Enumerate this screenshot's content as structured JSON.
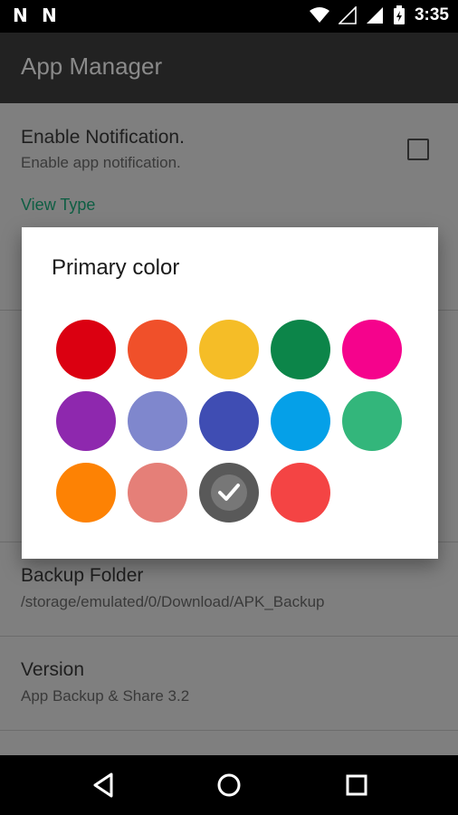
{
  "status_bar": {
    "time": "3:35",
    "left_icons": [
      "notification-n-icon",
      "notification-n-icon"
    ],
    "right_icons": [
      "wifi-icon",
      "signal-empty-icon",
      "signal-icon",
      "battery-icon"
    ]
  },
  "app_bar": {
    "title": "App Manager"
  },
  "settings": {
    "notification": {
      "title": "Enable Notification.",
      "subtitle": "Enable app notification."
    },
    "category_label": "View Type",
    "backup": {
      "title": "Backup Folder",
      "subtitle": "/storage/emulated/0/Download/APK_Backup"
    },
    "version": {
      "title": "Version",
      "subtitle": "App Backup & Share 3.2"
    }
  },
  "dialog": {
    "title": "Primary color",
    "colors": [
      "#db0011",
      "#f0502a",
      "#f5bd27",
      "#0c8549",
      "#f5038c",
      "#8e28ae",
      "#7f87cd",
      "#3f4db3",
      "#05a0e8",
      "#33b67b",
      "#fd8204",
      "#e57f78",
      "#595959",
      "#f44444"
    ],
    "selected_index": 12
  },
  "nav_bar": {
    "icons": [
      "back-icon",
      "home-icon",
      "recents-icon"
    ]
  }
}
